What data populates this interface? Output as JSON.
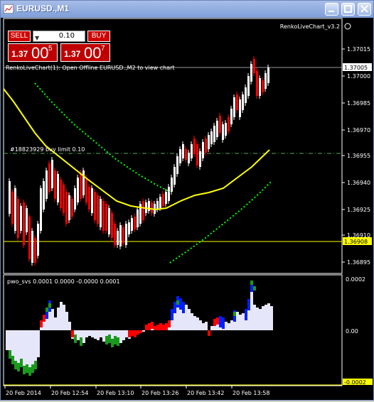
{
  "window": {
    "title": "EURUSD.,M1"
  },
  "trade_panel": {
    "sell_label": "SELL",
    "buy_label": "BUY",
    "lot": "0.10",
    "sell_price_a": "1.37",
    "sell_price_b": "00",
    "sell_price_c": "5",
    "buy_price_a": "1.37",
    "buy_price_b": "00",
    "buy_price_c": "7"
  },
  "chart": {
    "indicator_label": "RenkoLiveChart_v3.2",
    "info_text": "RenkoLiveChart(1): Open Offline EURUSD.,M2 to view chart",
    "order_label": "#18823929 buy limit 0.10",
    "current_price": "1.37005",
    "line_price": "1.36908",
    "price_ticks": [
      "1.37015",
      "1.37000",
      "1.36985",
      "1.36970",
      "1.36955",
      "1.36940",
      "1.36925",
      "1.36910",
      "1.36895"
    ],
    "time_ticks": [
      "20 Feb 2014",
      "20 Feb 12:54",
      "20 Feb 13:10",
      "20 Feb 13:26",
      "20 Feb 13:42",
      "20 Feb 13:58"
    ]
  },
  "sub_chart": {
    "label": "pwo_svs 0.0001 0.0000 -0.0000 0.0001",
    "ticks": [
      "0.0002",
      "0.00",
      "-0.0002"
    ]
  },
  "colors": {
    "bull": "#ffffff",
    "bear": "#ff0000",
    "ma": "#ffff00",
    "envelope": "#00ff00",
    "hist": "#e6e6fa"
  }
}
